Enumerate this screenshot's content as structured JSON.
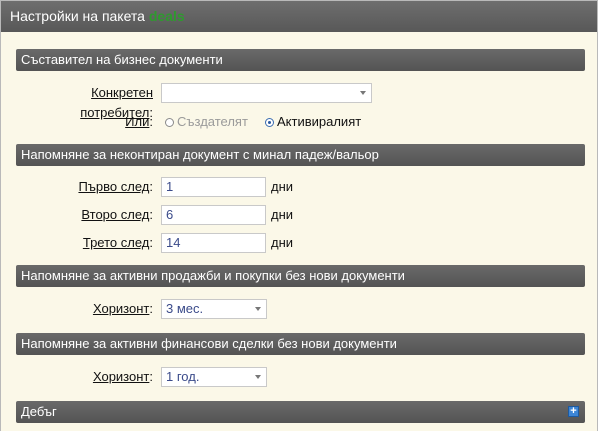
{
  "window": {
    "title": "Настройки на пакета",
    "title_accent": "deals"
  },
  "sections": {
    "composer": {
      "header": "Съставител на бизнес документи",
      "user_label_u": "Конкретен потребител",
      "user_label_rest": ":",
      "user_value": "",
      "or_label_u": "Или",
      "or_label_rest": ":",
      "radio_creator": "Създателят",
      "radio_activator": "Активиралият",
      "selected": "activator"
    },
    "reminder_overdue": {
      "header": "Напомняне за неконтиран документ с минал падеж/вальор",
      "first_label_u": "Първо след",
      "first_label_rest": ":",
      "first_value": "1",
      "second_label_u": "Второ след",
      "second_label_rest": ":",
      "second_value": "6",
      "third_label_u": "Трето след",
      "third_label_rest": ":",
      "third_value": "14",
      "unit": "дни"
    },
    "reminder_sales": {
      "header": "Напомняне за активни продажби и покупки без нови документи",
      "horizon_label_u": "Хоризонт",
      "horizon_label_rest": ":",
      "horizon_value": "3 мес."
    },
    "reminder_finance": {
      "header": "Напомняне за активни финансови сделки без нови документи",
      "horizon_label_u": "Хоризонт",
      "horizon_label_rest": ":",
      "horizon_value": "1 год."
    },
    "debug": {
      "header": "Дебъг",
      "expand_symbol": "+"
    }
  },
  "colors": {
    "title_accent": "#2e9a2e",
    "panel_bg": "#fbf8e8",
    "header_bg": "#5f5f5f",
    "input_text": "#3b4b8a",
    "radio_selected": "#2a5aa0"
  }
}
